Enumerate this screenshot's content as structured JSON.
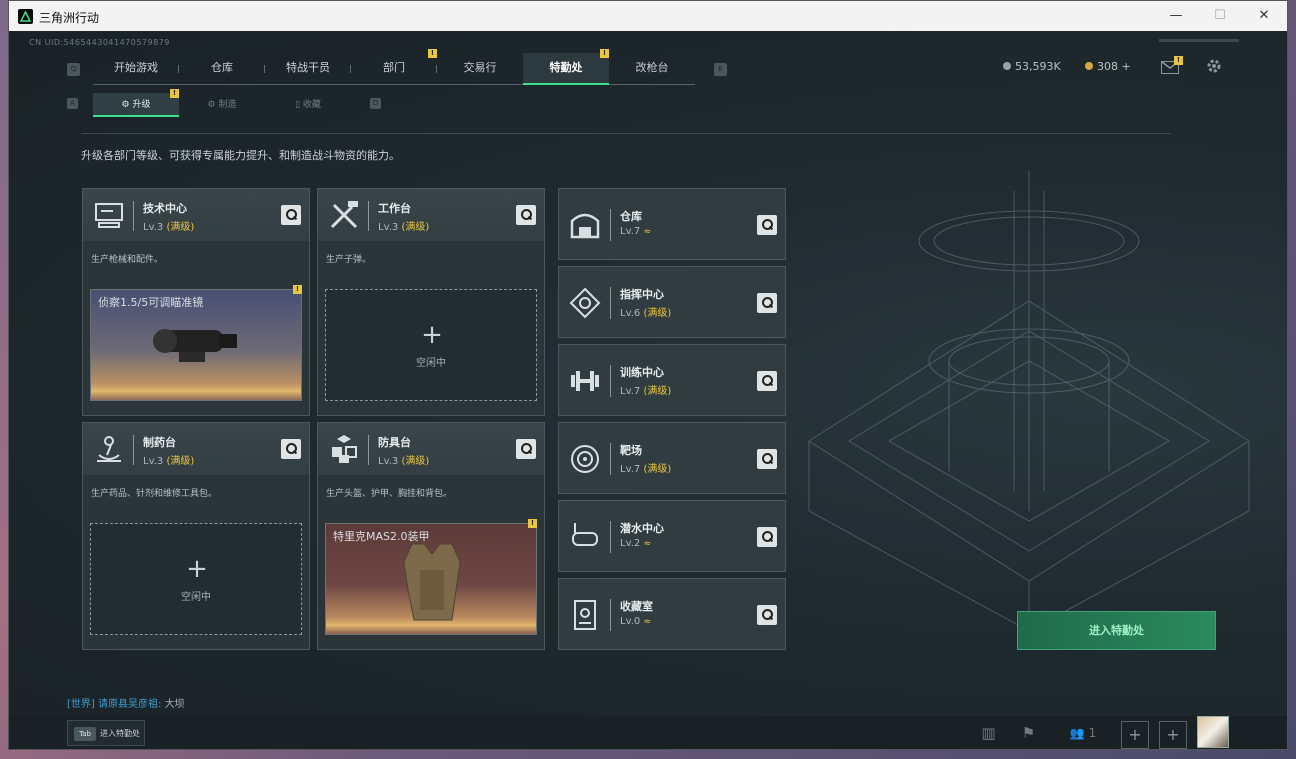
{
  "window": {
    "title": "三角洲行动",
    "min": "—",
    "max": "☐",
    "close": "✕"
  },
  "uid": "CN UID:5465443041470579879",
  "nav": {
    "left_key": "Q",
    "right_key": "E",
    "tabs": [
      {
        "label": "开始游戏"
      },
      {
        "label": "仓库"
      },
      {
        "label": "特战干员"
      },
      {
        "label": "部门",
        "badge": "!"
      },
      {
        "label": "交易行"
      },
      {
        "label": "特勤处",
        "badge": "!",
        "active": true
      },
      {
        "label": "改枪台"
      }
    ]
  },
  "currency": {
    "coins": "53,593K",
    "premium": "308 +"
  },
  "topicons": {
    "mail_badge": "!"
  },
  "subtabs": {
    "left_key": "A",
    "right_key": "D",
    "items": [
      {
        "label": "升级",
        "badge": "!",
        "active": true
      },
      {
        "label": "制造"
      },
      {
        "label": "收藏"
      }
    ]
  },
  "description": "升级各部门等级、可获得专属能力提升、和制造战斗物资的能力。",
  "cards": [
    {
      "name": "技术中心",
      "level": "Lv.3",
      "max": "(满级)",
      "desc": "生产枪械和配件。",
      "slot": {
        "type": "item",
        "name": "侦察1.5/5可调瞄准镜",
        "badge": "!"
      }
    },
    {
      "name": "工作台",
      "level": "Lv.3",
      "max": "(满级)",
      "desc": "生产子弹。",
      "slot": {
        "type": "empty",
        "plus": "+",
        "idle": "空闲中"
      }
    },
    {
      "name": "制药台",
      "level": "Lv.3",
      "max": "(满级)",
      "desc": "生产药品、针剂和维修工具包。",
      "slot": {
        "type": "empty",
        "plus": "+",
        "idle": "空闲中"
      }
    },
    {
      "name": "防具台",
      "level": "Lv.3",
      "max": "(满级)",
      "desc": "生产头盔、护甲、胸挂和背包。",
      "slot": {
        "type": "item",
        "name": "特里克MAS2.0装甲",
        "badge": "!"
      }
    }
  ],
  "right_cards": [
    {
      "name": "仓库",
      "level": "Lv.7",
      "suffix": "≈"
    },
    {
      "name": "指挥中心",
      "level": "Lv.6",
      "max": "(满级)"
    },
    {
      "name": "训练中心",
      "level": "Lv.7",
      "max": "(满级)"
    },
    {
      "name": "靶场",
      "level": "Lv.7",
      "max": "(满级)"
    },
    {
      "name": "潜水中心",
      "level": "Lv.2",
      "suffix": "≈"
    },
    {
      "name": "收藏室",
      "level": "Lv.0",
      "suffix": "≈"
    }
  ],
  "enter_button": "进入特勤处",
  "chat": {
    "channel": "[世界]",
    "user": "请原县吴彦祖:",
    "message": "大坝"
  },
  "bottom": {
    "tab_key": "Tab",
    "tab_label": "进入特勤处",
    "friends": "1",
    "plus": "+"
  }
}
